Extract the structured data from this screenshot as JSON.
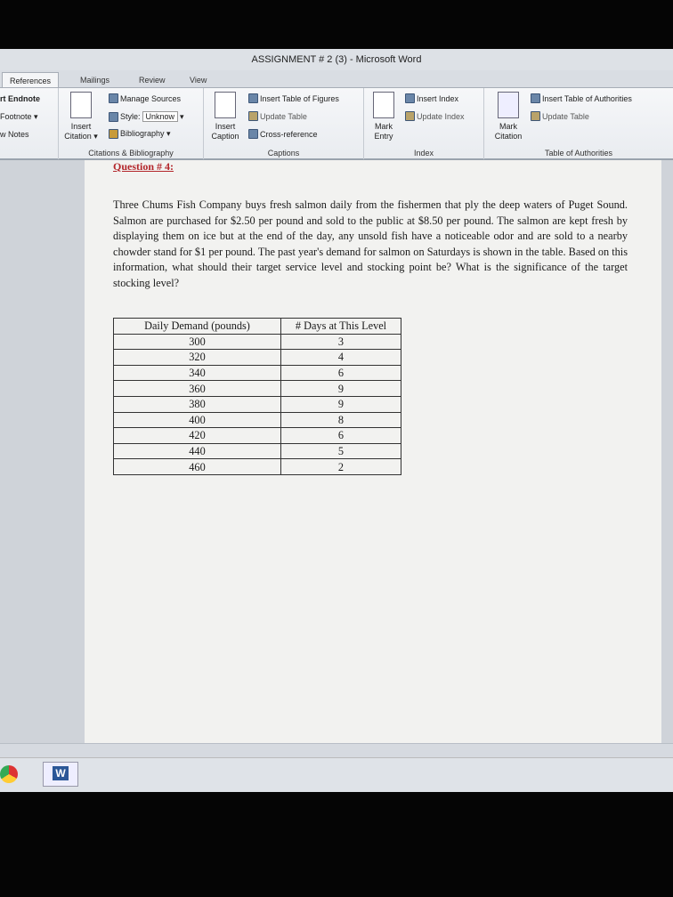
{
  "window": {
    "title": "ASSIGNMENT # 2 (3) - Microsoft Word"
  },
  "tabs": [
    {
      "label": "References",
      "active": true
    },
    {
      "label": "Mailings"
    },
    {
      "label": "Review"
    },
    {
      "label": "View"
    }
  ],
  "ribbon": {
    "footnotes": {
      "items": [
        "rt Endnote",
        "Footnote ▾",
        "w Notes"
      ]
    },
    "citations": {
      "insert_citation": "Insert Citation ▾",
      "manage_sources": "Manage Sources",
      "style_label": "Style:",
      "style_value": "Unknow",
      "bibliography": "Bibliography ▾",
      "label": "Citations & Bibliography"
    },
    "captions": {
      "insert_caption": "Insert Caption",
      "insert_tof": "Insert Table of Figures",
      "update_table": "Update Table",
      "cross_reference": "Cross-reference",
      "label": "Captions"
    },
    "index": {
      "mark_entry": "Mark Entry",
      "insert_index": "Insert Index",
      "update_index": "Update Index",
      "label": "Index"
    },
    "toa": {
      "mark_citation": "Mark Citation",
      "insert_toa": "Insert Table of Authorities",
      "update_table": "Update Table",
      "label": "Table of Authorities"
    }
  },
  "document": {
    "heading": "Question # 4:",
    "paragraph": "Three Chums Fish Company buys fresh salmon daily from the fishermen that ply the deep waters of Puget Sound. Salmon are purchased for $2.50 per pound and sold to the public at $8.50 per pound. The salmon are kept fresh by displaying them on ice but at the end of the day, any unsold fish have a noticeable odor and are sold to a nearby chowder stand for $1 per pound. The past year's demand for salmon on Saturdays is shown in the table. Based on this information, what should their target service level and stocking point be? What is the significance of the target stocking level?",
    "table": {
      "headers": [
        "Daily Demand (pounds)",
        "# Days at This Level"
      ],
      "rows": [
        [
          "300",
          "3"
        ],
        [
          "320",
          "4"
        ],
        [
          "340",
          "6"
        ],
        [
          "360",
          "9"
        ],
        [
          "380",
          "9"
        ],
        [
          "400",
          "8"
        ],
        [
          "420",
          "6"
        ],
        [
          "440",
          "5"
        ],
        [
          "460",
          "2"
        ]
      ]
    }
  },
  "taskbar": {
    "word_icon": "W"
  }
}
